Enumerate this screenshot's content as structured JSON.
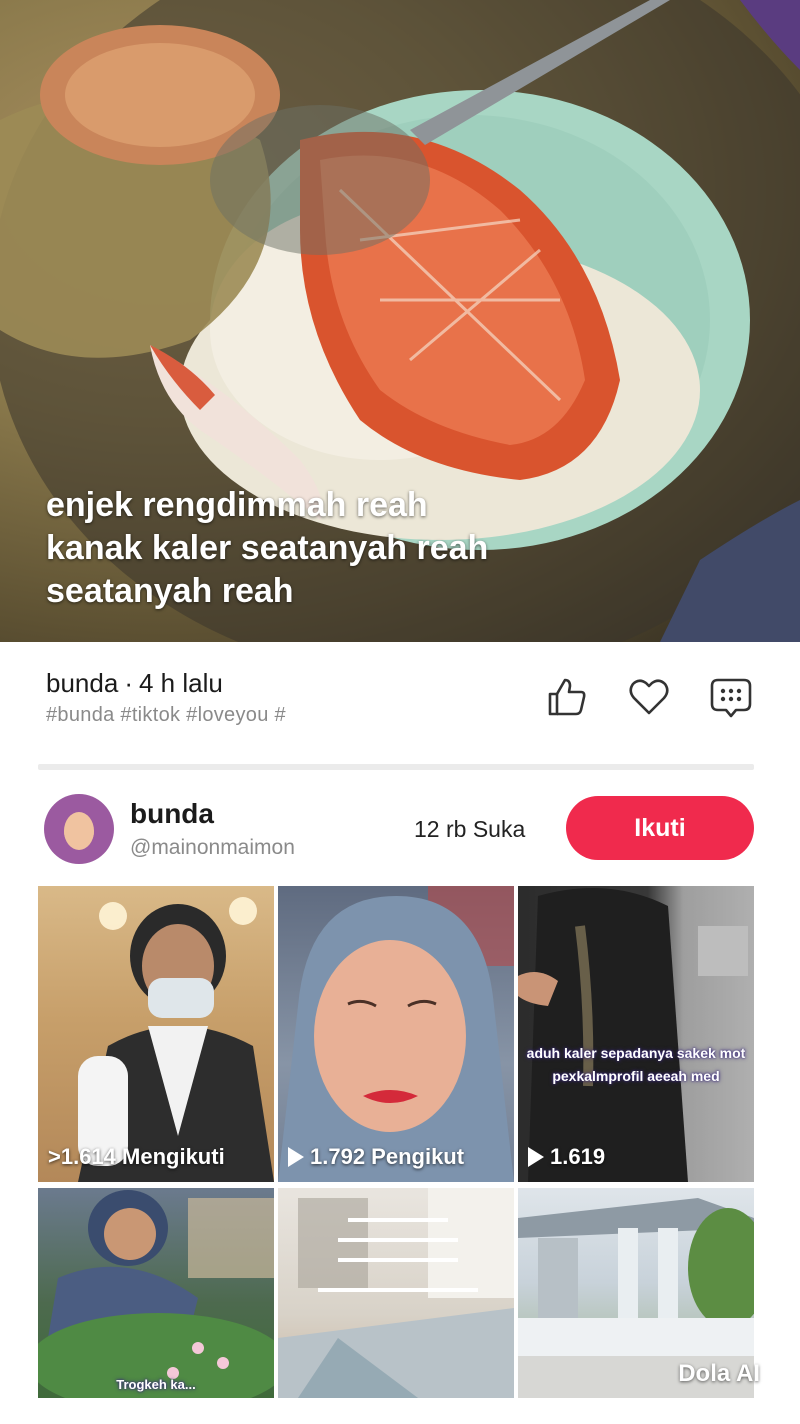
{
  "hero": {
    "caption_lines": [
      "enjek rengdimmah reah",
      "kanak kaler seatanyah reah",
      "seatanyah reah"
    ]
  },
  "post": {
    "author": "bunda",
    "separator": "·",
    "time": "4 h lalu",
    "hashtags": "#bunda #tiktok #loveyou #"
  },
  "actions": {
    "like_icon": "thumbs-up-icon",
    "favorite_icon": "heart-icon",
    "comment_icon": "comment-bubble-icon"
  },
  "profile": {
    "name": "bunda",
    "handle": "@mainonmaimon",
    "likes": "12 rb Suka",
    "follow_label": "Ikuti"
  },
  "videos": [
    {
      "stat": ">1.614 Mengikuti",
      "show_play": false
    },
    {
      "stat": "1.792 Pengikut",
      "show_play": true
    },
    {
      "stat": "1.619",
      "show_play": true,
      "overlay_text": "aduh kaler sepadanya sakek mot pexkalmprofil aeeah med"
    },
    {
      "overlay_text": "Trogkeh ka..."
    },
    {
      "overlay_text": ""
    },
    {
      "overlay_text": ""
    }
  ],
  "watermark": "Dola AI",
  "colors": {
    "accent": "#f02a4d",
    "muted_text": "#8a8a8a"
  }
}
